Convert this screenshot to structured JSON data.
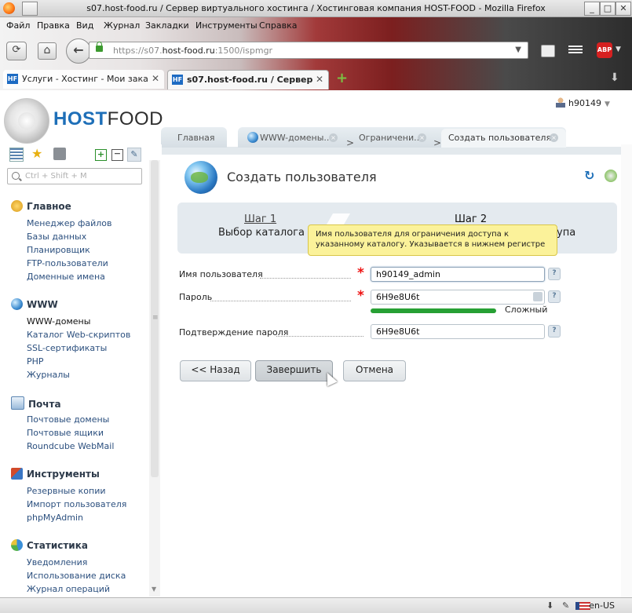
{
  "window": {
    "title": "s07.host-food.ru / Сервер виртуального хостинга / Хостинговая компания HOST-FOOD - Mozilla Firefox",
    "minimize": "_",
    "maximize": "□",
    "close": "✕"
  },
  "menu": {
    "file": "Файл",
    "edit": "Правка",
    "view": "Вид",
    "history": "Журнал",
    "bookmarks": "Закладки",
    "tools": "Инструменты",
    "help": "Справка"
  },
  "nav": {
    "url_scheme": "https://s07.",
    "url_host": "host-food.ru",
    "url_rest": ":1500/ispmgr",
    "abp": "ABP"
  },
  "browser_tabs": [
    {
      "favicon": "HF",
      "label": "Услуги - Хостинг - Мои заказ...",
      "close": "✕"
    },
    {
      "favicon": "HF",
      "label": "s07.host-food.ru / Сервер ...",
      "close": "✕"
    }
  ],
  "new_tab": "+",
  "logo": {
    "part1": "HOST",
    "part2": "FOOD"
  },
  "user": {
    "name": "h90149",
    "caret": "▼"
  },
  "page_tabs": {
    "home": "Главная",
    "www_domains": "WWW-домены...",
    "restrictions": "Ограничени...",
    "create_user": "Создать пользователя",
    "arrow": ">",
    "close": "×"
  },
  "sidebar": {
    "search_placeholder": "Ctrl + Shift + M",
    "sections": [
      {
        "title": "Главное",
        "icon": "home-icon",
        "items": [
          "Менеджер файлов",
          "Базы данных",
          "Планировщик",
          "FTP-пользователи",
          "Доменные имена"
        ]
      },
      {
        "title": "WWW",
        "icon": "globe-icon",
        "items": [
          "WWW-домены",
          "Каталог Web-скриптов",
          "SSL-сертификаты",
          "PHP",
          "Журналы"
        ]
      },
      {
        "title": "Почта",
        "icon": "mail-icon",
        "items": [
          "Почтовые домены",
          "Почтовые ящики",
          "Roundcube WebMail"
        ]
      },
      {
        "title": "Инструменты",
        "icon": "tools-icon",
        "items": [
          "Резервные копии",
          "Импорт пользователя",
          "phpMyAdmin"
        ]
      },
      {
        "title": "Статистика",
        "icon": "chart-icon",
        "items": [
          "Уведомления",
          "Использование диска",
          "Журнал операций"
        ]
      }
    ]
  },
  "main": {
    "title": "Создать пользователя",
    "wizard": {
      "step1_num": "Шаг 1",
      "step1_label": "Выбор каталога",
      "step2_num": "Шаг 2",
      "step2_label_tail": "упа"
    },
    "tooltip": "Имя пользователя для ограничения доступа к указанному каталогу. Указывается в нижнем регистре",
    "form": {
      "username_label": "Имя пользователя",
      "username_value": "h90149_admin",
      "password_label": "Пароль",
      "password_value": "6H9e8U6t",
      "strength_label": "Сложный",
      "confirm_label": "Подтверждение пароля",
      "confirm_value": "6H9e8U6t",
      "required_mark": "*",
      "help_mark": "?"
    },
    "buttons": {
      "back": "<< Назад",
      "finish": "Завершить",
      "cancel": "Отмена"
    }
  },
  "status": {
    "locale": "en-US"
  },
  "colors": {
    "accent_blue": "#1e6fb8",
    "link": "#2b4f7e",
    "tooltip_bg": "#fbf29a",
    "strength_green": "#27a034",
    "required_red": "#ee1111"
  }
}
